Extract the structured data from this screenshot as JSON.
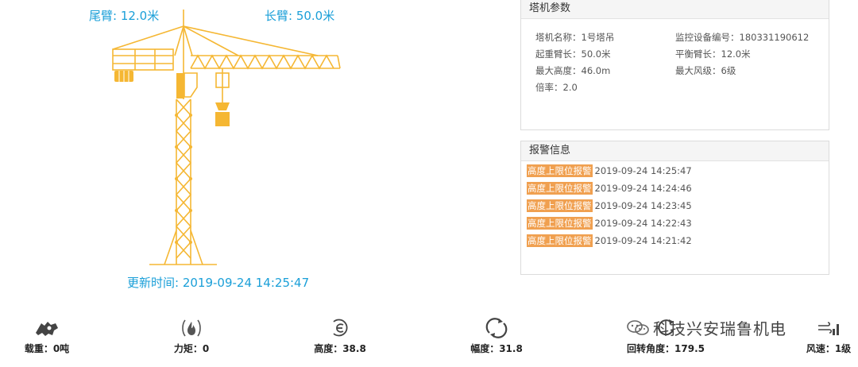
{
  "crane": {
    "tail_arm_label": "尾臂: 12.0米",
    "long_arm_label": "长臂: 50.0米",
    "update_time_label": "更新时间:  2019-09-24 14:25:47"
  },
  "params_panel": {
    "title": "塔机参数",
    "items": [
      {
        "text": "塔机名称：1号塔吊"
      },
      {
        "text": "监控设备编号：180331190612"
      },
      {
        "text": "起重臂长：50.0米"
      },
      {
        "text": "平衡臂长：12.0米"
      },
      {
        "text": "最大高度：46.0m"
      },
      {
        "text": "最大风级：6级"
      },
      {
        "text": "倍率：2.0"
      }
    ]
  },
  "alarm_panel": {
    "title": "报警信息",
    "items": [
      {
        "tag": "高度上限位报警",
        "time": "2019-09-24 14:25:47"
      },
      {
        "tag": "高度上限位报警",
        "time": "2019-09-24 14:24:46"
      },
      {
        "tag": "高度上限位报警",
        "time": "2019-09-24 14:23:45"
      },
      {
        "tag": "高度上限位报警",
        "time": "2019-09-24 14:22:43"
      },
      {
        "tag": "高度上限位报警",
        "time": "2019-09-24 14:21:42"
      }
    ]
  },
  "metrics": [
    {
      "icon": "load-weight-icon",
      "label": "载重：0吨"
    },
    {
      "icon": "torque-icon",
      "label": "力矩：0"
    },
    {
      "icon": "height-icon",
      "label": "高度：38.8"
    },
    {
      "icon": "amplitude-icon",
      "label": "幅度：31.8"
    },
    {
      "icon": "rotation-angle-icon",
      "label": "回转角度：179.5"
    },
    {
      "icon": "wind-speed-icon",
      "label": "风速：1级"
    }
  ],
  "watermark": "科技兴安瑞鲁机电",
  "colors": {
    "crane": "#f5b733",
    "label_blue": "#1a9fd8",
    "alarm_tag": "#f0a050"
  }
}
